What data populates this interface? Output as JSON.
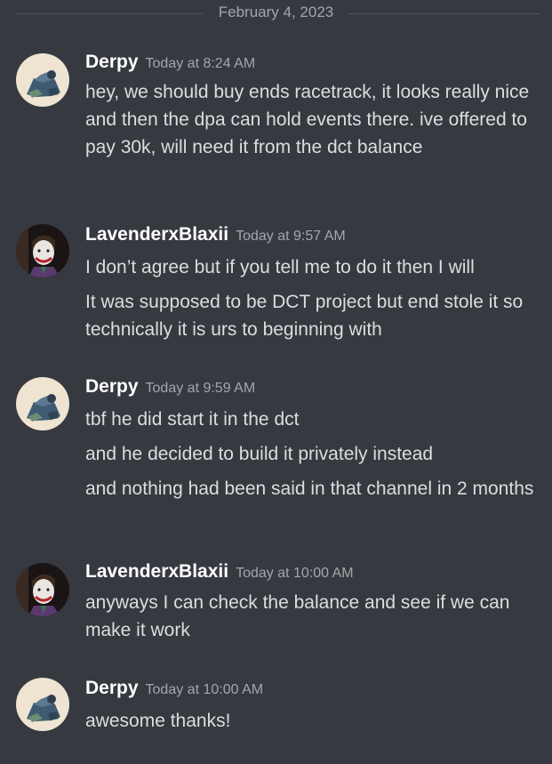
{
  "date_divider": "February 4, 2023",
  "messages": [
    {
      "author": "Derpy",
      "time": "Today at 8:24 AM",
      "avatar": "derpy-avatar",
      "lines": [
        "hey, we should buy ends racetrack, it looks really nice and then the dpa can hold events there. ive offered to pay 30k, will need it from the dct balance"
      ]
    },
    {
      "author": "LavenderxBlaxii",
      "time": "Today at 9:57 AM",
      "avatar": "lavender-avatar",
      "lines": [
        "I don’t agree but if you tell me to do it then I will",
        "It was supposed to be DCT project but end stole it so technically it is urs to beginning with"
      ]
    },
    {
      "author": "Derpy",
      "time": "Today at 9:59 AM",
      "avatar": "derpy-avatar",
      "lines": [
        "tbf he did start it in the dct",
        "and he decided to build it privately instead",
        "and nothing had been said in that channel in 2 months"
      ]
    },
    {
      "author": "LavenderxBlaxii",
      "time": "Today at 10:00 AM",
      "avatar": "lavender-avatar",
      "lines": [
        "anyways I can check the balance and see if we can make it work"
      ]
    },
    {
      "author": "Derpy",
      "time": "Today at 10:00 AM",
      "avatar": "derpy-avatar",
      "lines": [
        "awesome thanks!"
      ]
    }
  ],
  "colors": {
    "background": "#36393f",
    "username": "#ffffff",
    "timestamp": "#a3a6aa",
    "text": "#dcddde",
    "divider_line": "#4f545c"
  }
}
